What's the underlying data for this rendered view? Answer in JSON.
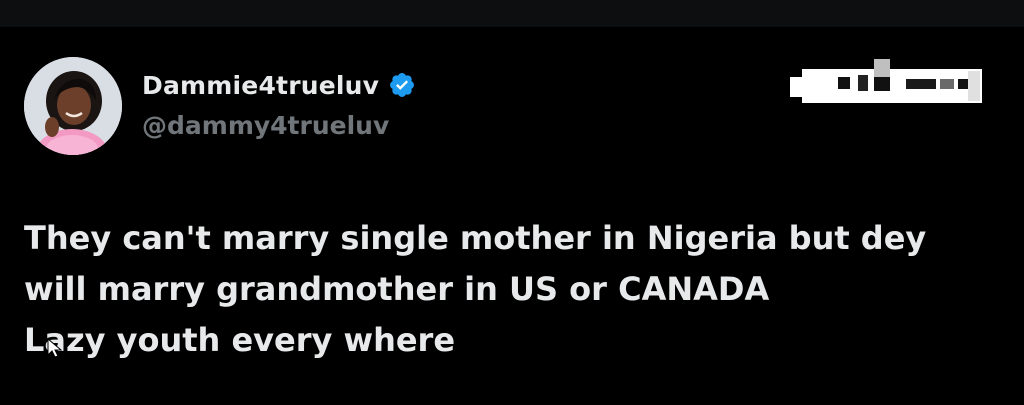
{
  "tweet": {
    "author": {
      "display_name": "Dammie4trueluv",
      "handle": "@dammy4trueluv",
      "verified": true,
      "verified_icon": "verified-badge-icon"
    },
    "menu_icon": "more-options-icon",
    "text_lines": [
      "They can't marry single mother in Nigeria but dey",
      "will marry grandmother in US or CANADA",
      "Lazy youth every where"
    ]
  },
  "colors": {
    "background": "#000000",
    "text_primary": "#e7e9ea",
    "text_secondary": "#71767b",
    "verified_blue": "#1d9bf0"
  }
}
